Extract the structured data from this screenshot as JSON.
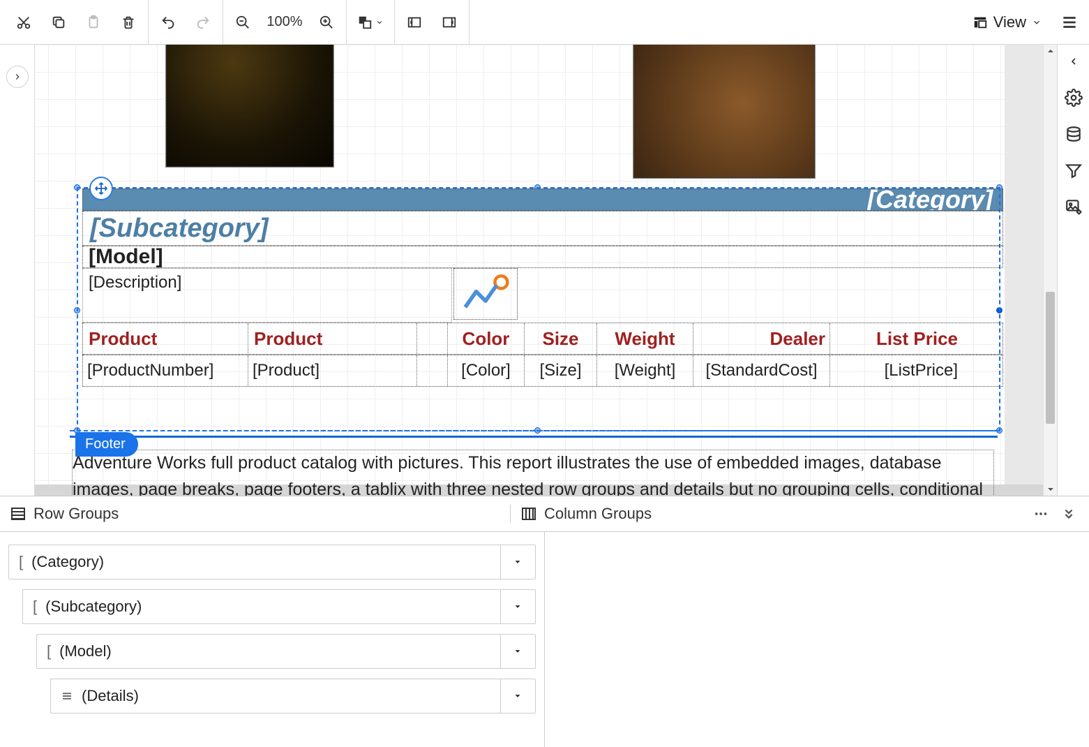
{
  "toolbar": {
    "zoom_label": "100%",
    "view_label": "View"
  },
  "design": {
    "category_placeholder": "[Category]",
    "subcategory_placeholder": "[Subcategory]",
    "model_placeholder": "[Model]",
    "description_placeholder": "[Description]",
    "columns": {
      "product_col1": "Product",
      "product_col2": "Product",
      "color": "Color",
      "size": "Size",
      "weight": "Weight",
      "dealer": "Dealer",
      "listprice": "List Price"
    },
    "data_fields": {
      "productnumber": "[ProductNumber]",
      "product": "[Product]",
      "color": "[Color]",
      "size": "[Size]",
      "weight": "[Weight]",
      "standardcost": "[StandardCost]",
      "listprice": "[ListPrice]"
    },
    "footer_label": "Footer",
    "footer_text": "Adventure Works full product catalog with pictures. This report illustrates the use of embedded images, database images, page breaks, page footers, a tablix with three nested row groups and details but no grouping cells, conditional formatting, and a document map."
  },
  "groups": {
    "row_groups_label": "Row Groups",
    "column_groups_label": "Column Groups",
    "items": [
      {
        "label": "(Category)"
      },
      {
        "label": "(Subcategory)"
      },
      {
        "label": "(Model)"
      },
      {
        "label": "(Details)"
      }
    ]
  }
}
